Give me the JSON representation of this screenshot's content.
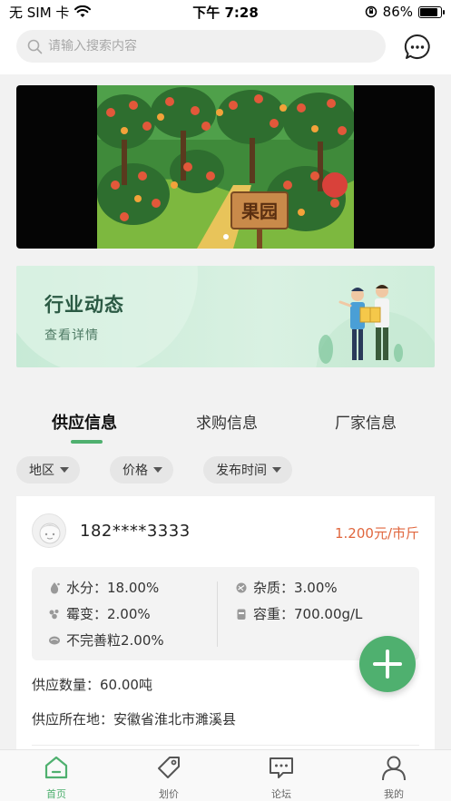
{
  "status_bar": {
    "carrier": "无 SIM 卡",
    "time": "下午 7:28",
    "battery_percent": "86%",
    "battery_level": 0.86
  },
  "header": {
    "search_placeholder": "请输入搜索内容",
    "search_icon": "search-icon",
    "message_icon": "chat-bubble-icon"
  },
  "banner": {
    "sign_text": "果园",
    "slide_count": 1,
    "active_slide": 1
  },
  "news_card": {
    "title": "行业动态",
    "link": "查看详情"
  },
  "tabs": [
    {
      "label": "供应信息",
      "active": true
    },
    {
      "label": "求购信息",
      "active": false
    },
    {
      "label": "厂家信息",
      "active": false
    }
  ],
  "filters": [
    {
      "label": "地区"
    },
    {
      "label": "价格"
    },
    {
      "label": "发布时间"
    }
  ],
  "listing": {
    "phone": "182****3333",
    "price": "1.200元/市斤",
    "specs": {
      "moisture": "水分：18.00%",
      "mildew": "霉变：2.00%",
      "imperfect": "不完善粒2.00%",
      "impurity": "杂质：3.00%",
      "bulk_density": "容重：700.00g/L"
    },
    "quantity": "供应数量：60.00吨",
    "location": "供应所在地：安徽省淮北市濉溪县"
  },
  "fab": {
    "icon": "plus-icon"
  },
  "bottom_nav": [
    {
      "label": "首页",
      "icon": "home-icon",
      "active": true
    },
    {
      "label": "划价",
      "icon": "tag-icon",
      "active": false
    },
    {
      "label": "论坛",
      "icon": "forum-icon",
      "active": false
    },
    {
      "label": "我的",
      "icon": "user-icon",
      "active": false
    }
  ],
  "colors": {
    "accent": "#4fb06f",
    "price": "#e0663d",
    "news_bg": "#d9f1e2"
  }
}
